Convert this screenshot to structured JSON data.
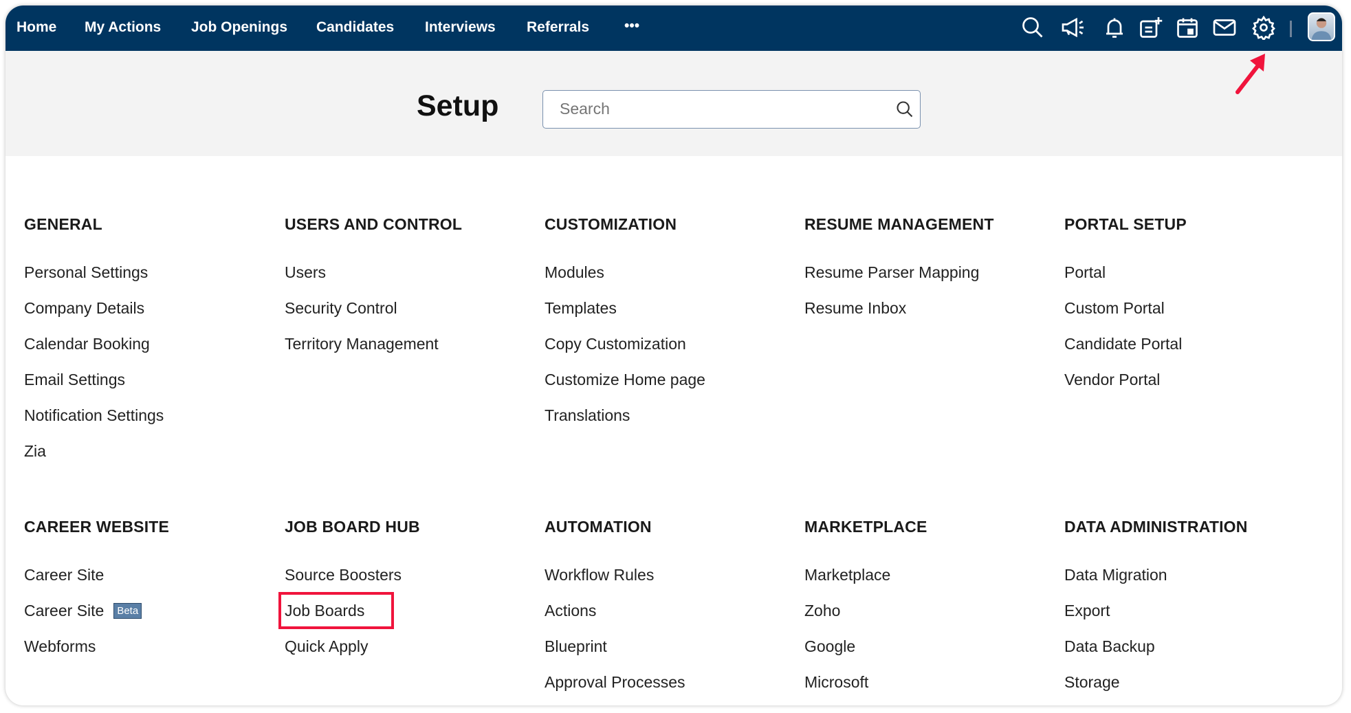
{
  "nav": {
    "items": [
      "Home",
      "My Actions",
      "Job Openings",
      "Candidates",
      "Interviews",
      "Referrals"
    ],
    "more": "•••",
    "icons": [
      "search-icon",
      "announcement-icon",
      "bell-icon",
      "add-note-icon",
      "calendar-icon",
      "mail-icon",
      "gear-icon"
    ]
  },
  "header": {
    "title": "Setup",
    "search_placeholder": "Search"
  },
  "sections": [
    {
      "title": "GENERAL",
      "items": [
        "Personal Settings",
        "Company Details",
        "Calendar Booking",
        "Email Settings",
        "Notification Settings",
        "Zia"
      ]
    },
    {
      "title": "USERS AND CONTROL",
      "items": [
        "Users",
        "Security Control",
        "Territory Management"
      ]
    },
    {
      "title": "CUSTOMIZATION",
      "items": [
        "Modules",
        "Templates",
        "Copy Customization",
        "Customize Home page",
        "Translations"
      ]
    },
    {
      "title": "RESUME MANAGEMENT",
      "items": [
        "Resume Parser Mapping",
        "Resume Inbox"
      ]
    },
    {
      "title": "PORTAL SETUP",
      "items": [
        "Portal",
        "Custom Portal",
        "Candidate Portal",
        "Vendor Portal"
      ]
    },
    {
      "title": "CAREER WEBSITE",
      "items": [
        "Career Site",
        "Career Site",
        "Webforms"
      ],
      "badge": "Beta"
    },
    {
      "title": "JOB BOARD HUB",
      "items": [
        "Source Boosters",
        "Job Boards",
        "Quick Apply"
      ]
    },
    {
      "title": "AUTOMATION",
      "items": [
        "Workflow Rules",
        "Actions",
        "Blueprint",
        "Approval Processes"
      ]
    },
    {
      "title": "MARKETPLACE",
      "items": [
        "Marketplace",
        "Zoho",
        "Google",
        "Microsoft"
      ]
    },
    {
      "title": "DATA ADMINISTRATION",
      "items": [
        "Data Migration",
        "Export",
        "Data Backup",
        "Storage"
      ]
    }
  ],
  "colors": {
    "nav": "#003560",
    "highlight": "#f0143c"
  }
}
